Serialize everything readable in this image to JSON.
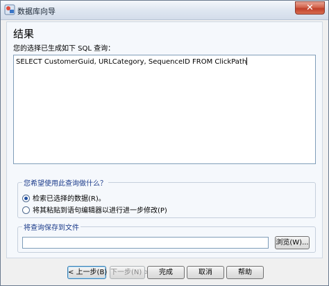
{
  "window": {
    "title": "数据库向导"
  },
  "page": {
    "heading": "结果",
    "prompt": "您的选择已生成如下 SQL 查询：",
    "sql_query": "SELECT CustomerGuid, URLCategory, SequenceID FROM ClickPath"
  },
  "usage_group": {
    "title": "您希望使用此查询做什么？",
    "options": [
      {
        "label": "检索已选择的数据(R)。",
        "selected": true
      },
      {
        "label": "将其粘贴到语句编辑器以进行进一步修改(P)",
        "selected": false
      }
    ]
  },
  "save_group": {
    "title": "将查询保存到文件",
    "file_value": "",
    "browse_label": "浏览(W)..."
  },
  "buttons": {
    "back": "< 上一步(B)",
    "next": "下一步(N) >",
    "finish": "完成",
    "cancel": "取消",
    "help": "帮助"
  },
  "colors": {
    "group_title": "#1a3a8a",
    "close_button": "#c0402a"
  }
}
